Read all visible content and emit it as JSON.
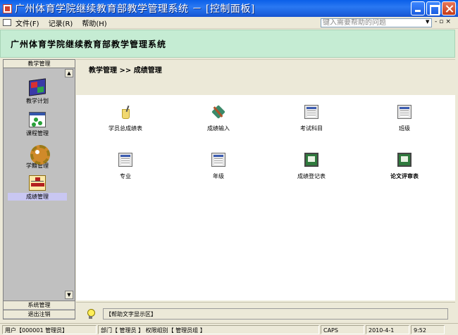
{
  "window": {
    "title": "广州体育学院继续教育部教学管理系统 － [控制面板]"
  },
  "menubar": {
    "items": [
      "文件(F)",
      "记录(R)",
      "帮助(H)"
    ],
    "help_placeholder": "键入需要帮助的问题"
  },
  "header": {
    "title": "广州体育学院继续教育部教学管理系统"
  },
  "sidebar": {
    "header": "教学管理",
    "items": [
      {
        "label": "教学计划",
        "icon": "cube-icon"
      },
      {
        "label": "课程管理",
        "icon": "dots-icon"
      },
      {
        "label": "学籍管理",
        "icon": "gear-icon"
      },
      {
        "label": "成绩管理",
        "icon": "org-icon",
        "active": true
      }
    ],
    "footer": [
      "系统管理",
      "退出注销"
    ]
  },
  "main": {
    "breadcrumb": "教学管理 >> 成绩管理",
    "tiles": [
      {
        "label": "学员总成绩表",
        "icon": "cup-icon"
      },
      {
        "label": "成绩输入",
        "icon": "tools-icon"
      },
      {
        "label": "考试科目",
        "icon": "form-icon"
      },
      {
        "label": "班级",
        "icon": "form-icon"
      },
      {
        "label": "专业",
        "icon": "form-icon"
      },
      {
        "label": "年级",
        "icon": "form-icon"
      },
      {
        "label": "成绩登记表",
        "icon": "monitor-icon"
      },
      {
        "label": "论文评审表",
        "icon": "monitor-icon",
        "bold": true
      }
    ]
  },
  "helpbar": {
    "text": "【帮助文字显示区】"
  },
  "statusbar": {
    "user": "用户【000001 管理员】",
    "dept": "部门【 管理员 】 权限组别【 管理员组 】",
    "caps": "CAPS",
    "date": "2010-4-1",
    "time": "9:52"
  }
}
